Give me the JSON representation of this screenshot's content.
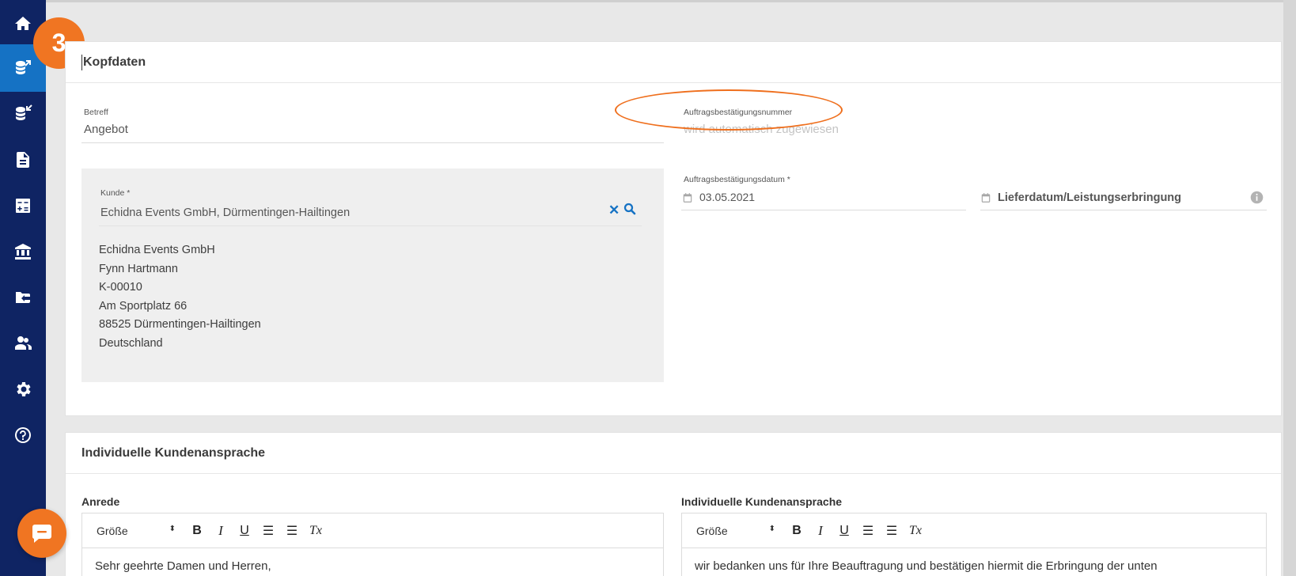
{
  "sidebar": {
    "items": [
      {
        "icon": "home-icon",
        "active": false
      },
      {
        "icon": "outgoing-invoices-icon",
        "active": true
      },
      {
        "icon": "incoming-invoices-icon",
        "active": false
      },
      {
        "icon": "document-icon",
        "active": false
      },
      {
        "icon": "calculator-icon",
        "active": false
      },
      {
        "icon": "bank-icon",
        "active": false
      },
      {
        "icon": "folder-export-icon",
        "active": false
      },
      {
        "icon": "contacts-icon",
        "active": false
      },
      {
        "icon": "settings-icon",
        "active": false
      },
      {
        "icon": "help-icon",
        "active": false
      }
    ]
  },
  "callout": {
    "number": "3"
  },
  "colors": {
    "sidebar": "#0f2463",
    "active": "#1572c4",
    "accent": "#f07522",
    "link": "#1572c4"
  },
  "kopfdaten": {
    "title": "Kopfdaten",
    "betreff": {
      "label": "Betreff",
      "value": "Angebot"
    },
    "ab_nummer": {
      "label": "Auftragsbestätigungsnummer",
      "placeholder": "wird automatisch zugewiesen"
    },
    "kunde": {
      "label": "Kunde *",
      "value": "Echidna Events GmbH, Dürmentingen-Hailtingen",
      "address": [
        "Echidna Events GmbH",
        "Fynn Hartmann",
        "K-00010",
        "Am Sportplatz 66",
        "88525 Dürmentingen-Hailtingen",
        "Deutschland"
      ]
    },
    "ab_datum": {
      "label": "Auftragsbestätigungsdatum *",
      "value": "03.05.2021"
    },
    "lieferdatum": {
      "placeholder": "Lieferdatum/Leistungserbringung"
    }
  },
  "ansprache": {
    "title": "Individuelle Kundenansprache",
    "anrede": {
      "label": "Anrede",
      "text": "Sehr geehrte Damen und Herren,"
    },
    "individuell": {
      "label": "Individuelle Kundenansprache",
      "text": "wir bedanken uns für Ihre Beauftragung und bestätigen hiermit die Erbringung der unten"
    },
    "toolbar": {
      "size_label": "Größe",
      "bold": "B",
      "italic": "I",
      "underline": "U",
      "clear": "Tx"
    }
  }
}
